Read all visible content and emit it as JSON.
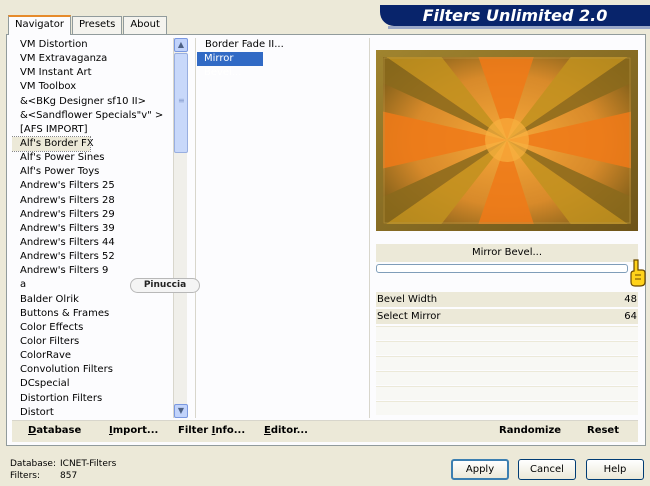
{
  "tabs": [
    {
      "label": "Navigator"
    },
    {
      "label": "Presets"
    },
    {
      "label": "About"
    }
  ],
  "banner": {
    "title": "Filters Unlimited 2.0"
  },
  "categories": [
    "VM Distortion",
    "VM Extravaganza",
    "VM Instant Art",
    "VM Toolbox",
    "&<BKg Designer sf10 II>",
    "&<Sandflower Specials\"v\" >",
    "[AFS IMPORT]",
    "Alf's Border FX",
    "Alf's Power Sines",
    "Alf's Power Toys",
    "Andrew's Filters 25",
    "Andrew's Filters 28",
    "Andrew's Filters 29",
    "Andrew's Filters 39",
    "Andrew's Filters 44",
    "Andrew's Filters 52",
    "Andrew's Filters 9",
    "a",
    "Balder Olrik",
    "Buttons & Frames",
    "Color Effects",
    "Color Filters",
    "ColorRave",
    "Convolution Filters",
    "DCspecial",
    "Distortion Filters",
    "Distort"
  ],
  "selected_category": "Alf's Border FX",
  "filters": [
    "Border Fade II...",
    "Mirror Bevel..."
  ],
  "selected_filter": "Mirror Bevel...",
  "filter_name": "Mirror Bevel...",
  "params": [
    {
      "name": "Bevel Width",
      "value": "48"
    },
    {
      "name": "Select Mirror",
      "value": "64"
    }
  ],
  "watermark": "Pinuccia",
  "bottom_buttons": {
    "database": {
      "first": "D",
      "rest": "atabase"
    },
    "import": {
      "first": "I",
      "rest": "mport..."
    },
    "filter_info": {
      "first": "Filter ",
      "under": "I",
      "rest": "nfo..."
    },
    "editor": {
      "first": "E",
      "rest": "ditor..."
    },
    "randomize": "Randomize",
    "reset": "Reset"
  },
  "status": {
    "database_label": "Database:",
    "database_value": "ICNET-Filters",
    "filters_label": "Filters:",
    "filters_value": "857"
  },
  "dialog_buttons": {
    "apply": "Apply",
    "cancel": "Cancel",
    "help": "Help"
  },
  "colors": {
    "accent": "#316ac5",
    "banner": "#08246b",
    "preview_dark": "#8a6a1c",
    "preview_bright": "#f07818"
  },
  "icons": {
    "scroll_up": "chevron-up-icon",
    "scroll_down": "chevron-down-icon",
    "pointer": "pointing-hand-icon"
  }
}
